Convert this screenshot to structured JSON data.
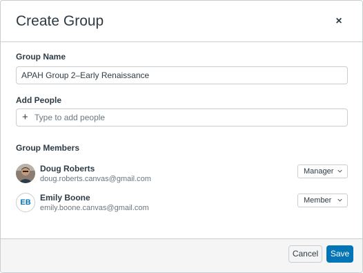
{
  "dialog": {
    "title": "Create Group",
    "close_icon": "close-icon",
    "close_symbol": "×"
  },
  "group_name": {
    "label": "Group Name",
    "value": "APAH Group 2–Early Renaissance"
  },
  "add_people": {
    "label": "Add People",
    "placeholder": "Type to add people",
    "plus_icon": "plus-icon",
    "plus_symbol": "+"
  },
  "members_section": {
    "label": "Group Members",
    "members": [
      {
        "name": "Doug Roberts",
        "email": "doug.roberts.canvas@gmail.com",
        "avatar": "photo",
        "role": "Manager"
      },
      {
        "name": "Emily Boone",
        "email": "emily.boone.canvas@gmail.com",
        "avatar_initials": "EB",
        "role": "Member"
      }
    ]
  },
  "footer": {
    "cancel_label": "Cancel",
    "save_label": "Save"
  },
  "colors": {
    "accent": "#0374b5",
    "border": "#c7cdd1",
    "text": "#2d3b45",
    "muted_text": "#6b7780",
    "footer_bg": "#f5f5f5"
  }
}
